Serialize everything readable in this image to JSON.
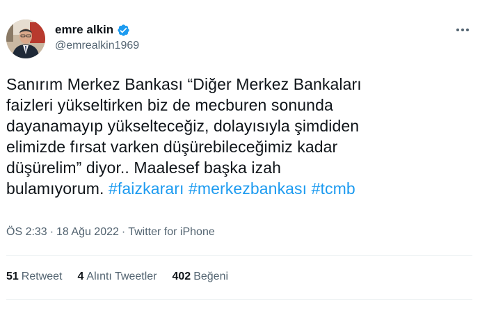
{
  "author": {
    "display_name": "emre alkin",
    "handle": "@emrealkin1969",
    "verified_color": "#1d9bf0"
  },
  "tweet": {
    "lines": [
      "Sanırım Merkez Bankası “Diğer Merkez Bankaları",
      "faizleri yükseltirken biz de mecburen sonunda",
      "dayanamayıp yükselteceğiz, dolayısıyla şimdiden",
      "elimizde fırsat varken düşürebileceğimiz kadar",
      "düşürelim” diyor.. Maalesef başka izah"
    ],
    "last_line_text": "bulamıyorum. ",
    "hashtags": [
      "#faizkararı",
      "#merkezbankası",
      "#tcmb"
    ],
    "hashtag_color": "#1d9bf0"
  },
  "meta": {
    "time": "ÖS 2:33",
    "separator": "·",
    "date": "18 Ağu 2022",
    "source": "Twitter for iPhone"
  },
  "stats": {
    "retweets": {
      "count": "51",
      "label": "Retweet"
    },
    "quotes": {
      "count": "4",
      "label": "Alıntı Tweetler"
    },
    "likes": {
      "count": "402",
      "label": "Beğeni"
    }
  },
  "icons": {
    "more": "more-horizontal-icon",
    "verified": "verified-badge-icon"
  }
}
